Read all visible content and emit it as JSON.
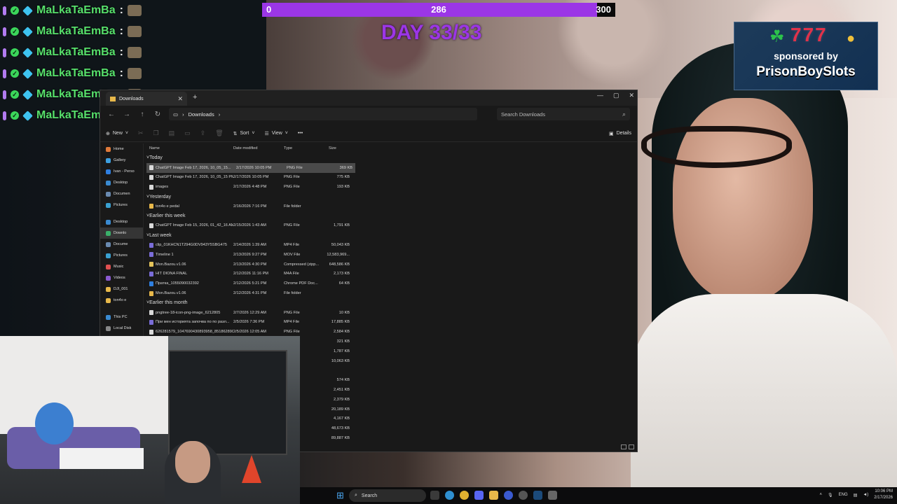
{
  "chat": {
    "lines": [
      {
        "user": "MaLkaTaEmBa",
        "sep": ":"
      },
      {
        "user": "MaLkaTaEmBa",
        "sep": ":"
      },
      {
        "user": "MaLkaTaEmBa",
        "sep": ":"
      },
      {
        "user": "MaLkaTaEmBa",
        "sep": ":"
      },
      {
        "user": "MaLkaTaEmBa",
        "sep": ":"
      },
      {
        "user": "MaLkaTaEmBa",
        "sep": ":"
      }
    ]
  },
  "goal": {
    "min": "0",
    "current": "286",
    "max": "300",
    "fill_fraction": 0.953,
    "color": "#9b36e6"
  },
  "day_counter": "DAY 33/33",
  "sponsor": {
    "numbers": "777",
    "line1": "sponsored by",
    "brand": "PrisonBoySlots"
  },
  "explorer": {
    "tab_title": "Downloads",
    "path_label": "Downloads",
    "search_placeholder": "Search Downloads",
    "toolbar": {
      "new_label": "New",
      "sort_label": "Sort",
      "view_label": "View",
      "more_label": "•••",
      "details_label": "Details"
    },
    "sidebar": [
      {
        "label": "Home",
        "color": "#e07a3a",
        "active": false
      },
      {
        "label": "Gallery",
        "color": "#3ea0e0",
        "active": false
      },
      {
        "label": "Ivan - Perso",
        "color": "#2f7fe0",
        "active": false
      },
      {
        "label": "Desktop",
        "color": "#3a8ad0",
        "active": false
      },
      {
        "label": "Documen",
        "color": "#6a8ab0",
        "active": false
      },
      {
        "label": "Pictures",
        "color": "#3aa0d0",
        "active": false
      },
      {
        "label": "",
        "color": "",
        "active": false
      },
      {
        "label": "Desktop",
        "color": "#3a8ad0",
        "active": false
      },
      {
        "label": "Downlo",
        "color": "#3ab06a",
        "active": true
      },
      {
        "label": "Docume",
        "color": "#6a8ab0",
        "active": false
      },
      {
        "label": "Pictures",
        "color": "#3aa0d0",
        "active": false
      },
      {
        "label": "Music",
        "color": "#e05050",
        "active": false
      },
      {
        "label": "Videos",
        "color": "#8a5ad0",
        "active": false
      },
      {
        "label": "DJI_001",
        "color": "#e8b84a",
        "active": false
      },
      {
        "label": "ton4o e",
        "color": "#e8b84a",
        "active": false
      },
      {
        "label": "",
        "color": "",
        "active": false
      },
      {
        "label": "This PC",
        "color": "#3a8ad0",
        "active": false
      },
      {
        "label": "Local Disk",
        "color": "#888888",
        "active": false
      }
    ],
    "columns": {
      "name": "Name",
      "date": "Date modified",
      "type": "Type",
      "size": "Size"
    },
    "groups": [
      {
        "title": "Today",
        "rows": [
          {
            "name": "ChatGPT Image Feb 17, 2026, 10_05_15...",
            "date": "2/17/2026 10:05 PM",
            "type": "PNG File",
            "size": "369 KB",
            "icon": "png",
            "selected": true
          },
          {
            "name": "ChatGPT Image Feb 17, 2026, 10_05_15 PM",
            "date": "2/17/2026 10:05 PM",
            "type": "PNG File",
            "size": "775 KB",
            "icon": "png",
            "selected": false
          },
          {
            "name": "images",
            "date": "2/17/2026 4:48 PM",
            "type": "PNG File",
            "size": "193 KB",
            "icon": "png",
            "selected": false
          }
        ]
      },
      {
        "title": "Yesterday",
        "rows": [
          {
            "name": "ton4o e pedal",
            "date": "2/16/2026 7:16 PM",
            "type": "File folder",
            "size": "",
            "icon": "folder",
            "selected": false
          }
        ]
      },
      {
        "title": "Earlier this week",
        "rows": [
          {
            "name": "ChatGPT Image Feb 15, 2026, 01_42_16 AM",
            "date": "2/15/2026 1:43 AM",
            "type": "PNG File",
            "size": "1,791 KB",
            "icon": "png",
            "selected": false
          }
        ]
      },
      {
        "title": "Last week",
        "rows": [
          {
            "name": "clip_01KHCN1T294G0DV943Y5SBG475",
            "date": "2/14/2026 1:39 AM",
            "type": "MP4 File",
            "size": "50,043 KB",
            "icon": "mp4",
            "selected": false
          },
          {
            "name": "Timeline 1",
            "date": "2/13/2026 9:27 PM",
            "type": "MOV File",
            "size": "12,583,969...",
            "icon": "mp4",
            "selected": false
          },
          {
            "name": "Mon.Bazou.v1.06",
            "date": "2/13/2026 4:30 PM",
            "type": "Compressed (zipp...",
            "size": "648,586 KB",
            "icon": "zip",
            "selected": false
          },
          {
            "name": "HIT DIONA FINAL",
            "date": "2/12/2026 11:16 PM",
            "type": "M4A File",
            "size": "2,173 KB",
            "icon": "mp4",
            "selected": false
          },
          {
            "name": "Пратка_1055090032392",
            "date": "2/12/2026 5:21 PM",
            "type": "Chrome PDF Doc...",
            "size": "64 KB",
            "icon": "pdf",
            "selected": false
          },
          {
            "name": "Mon.Bazou.v1.06",
            "date": "2/12/2026 4:31 PM",
            "type": "File folder",
            "size": "",
            "icon": "folder",
            "selected": false
          }
        ]
      },
      {
        "title": "Earlier this month",
        "rows": [
          {
            "name": "pngtree-18-icon-png-image_6212805",
            "date": "2/7/2026 12:29 AM",
            "type": "PNG File",
            "size": "10 KB",
            "icon": "png",
            "selected": false
          },
          {
            "name": "При мен историята започва по по разл...",
            "date": "2/5/2026 7:36 PM",
            "type": "MP4 File",
            "size": "17,885 KB",
            "icon": "mp4",
            "selected": false
          },
          {
            "name": "626281579_1047690430893958_851862890...",
            "date": "2/5/2026 12:05 AM",
            "type": "PNG File",
            "size": "2,584 KB",
            "icon": "png",
            "selected": false
          }
        ]
      }
    ],
    "partial_rows": [
      {
        "type": "File",
        "size": "321 KB"
      },
      {
        "type": "File",
        "size": "1,787 KB"
      },
      {
        "type": "File",
        "size": "10,063 KB"
      },
      {
        "type": "",
        "size": ""
      },
      {
        "type": "File",
        "size": "574 KB"
      },
      {
        "type": "File",
        "size": "2,451 KB"
      },
      {
        "type": "File",
        "size": "2,379 KB"
      },
      {
        "type": "File",
        "size": "20,189 KB"
      },
      {
        "type": "File",
        "size": "4,167 KB"
      },
      {
        "type": "File",
        "size": "48,673 KB"
      },
      {
        "type": "File",
        "size": "89,887 KB"
      }
    ]
  },
  "taskbar": {
    "search_label": "Search",
    "lang": "ENG",
    "time": "10:06 PM",
    "date": "2/17/2026"
  }
}
